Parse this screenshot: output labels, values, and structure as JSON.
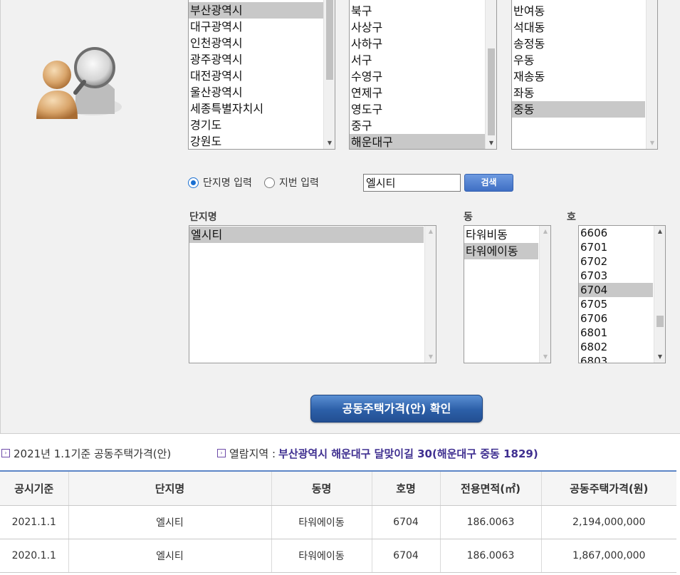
{
  "regions": {
    "sido": [
      "부산광역시",
      "대구광역시",
      "인천광역시",
      "광주광역시",
      "대전광역시",
      "울산광역시",
      "세종특별자치시",
      "경기도",
      "강원도"
    ],
    "sido_selected": "부산광역시",
    "sigungu": [
      "북구",
      "사상구",
      "사하구",
      "서구",
      "수영구",
      "연제구",
      "영도구",
      "중구",
      "해운대구"
    ],
    "sigungu_selected": "해운대구",
    "dong": [
      "반여동",
      "석대동",
      "송정동",
      "우동",
      "재송동",
      "좌동",
      "중동"
    ],
    "dong_selected": "중동"
  },
  "search": {
    "radio_complex": "단지명 입력",
    "radio_lot": "지번 입력",
    "selected_mode": "단지명 입력",
    "value": "엘시티",
    "button": "검색"
  },
  "labels": {
    "complex": "단지명",
    "building": "동",
    "unit": "호"
  },
  "complex_list": [
    "엘시티"
  ],
  "complex_selected": "엘시티",
  "building_list": [
    "타워비동",
    "타워에이동"
  ],
  "building_selected": "타워에이동",
  "unit_list": [
    "6606",
    "6701",
    "6702",
    "6703",
    "6704",
    "6705",
    "6706",
    "6801",
    "6802",
    "6803"
  ],
  "unit_selected": "6704",
  "confirm_button": "공동주택가격(안) 확인",
  "info": {
    "basis": "2021년 1.1기준 공동주택가격(안)",
    "view_label": "열람지역 :",
    "view_location": "부산광역시 해운대구 달맞이길 30(해운대구 중동 1829)"
  },
  "table": {
    "headers": [
      "공시기준",
      "단지명",
      "동명",
      "호명",
      "전용면적(㎡)",
      "공동주택가격(원)"
    ],
    "rows": [
      [
        "2021.1.1",
        "엘시티",
        "타워에이동",
        "6704",
        "186.0063",
        "2,194,000,000"
      ],
      [
        "2020.1.1",
        "엘시티",
        "타워에이동",
        "6704",
        "186.0063",
        "1,867,000,000"
      ]
    ]
  },
  "colors": {
    "accent": "#2c5fa8",
    "table_border": "#5d86c6",
    "location_text": "#3f2f90"
  }
}
